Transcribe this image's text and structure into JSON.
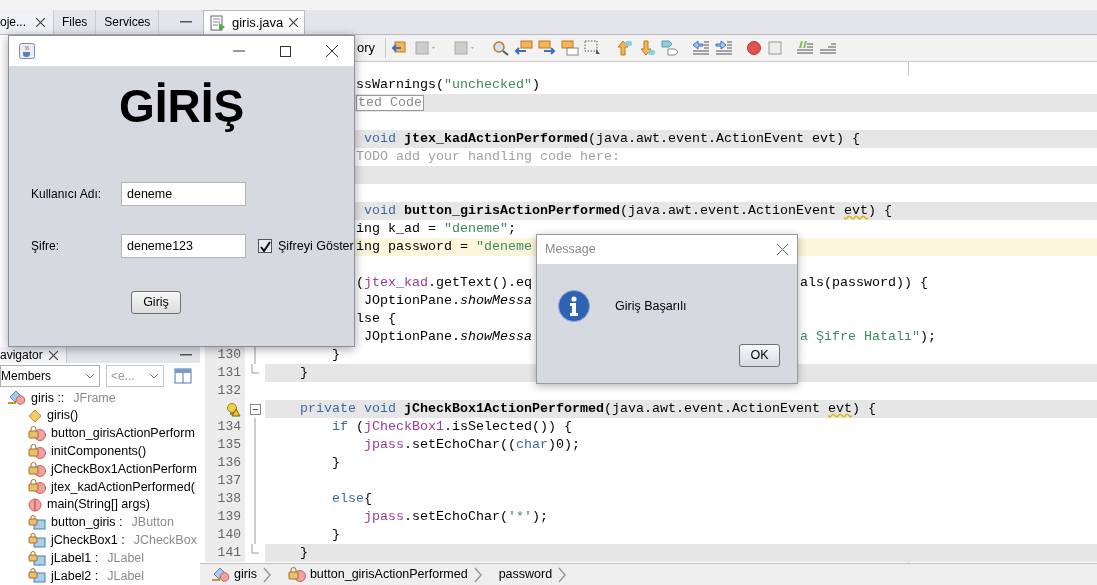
{
  "panel_tabs": [
    {
      "label": "oje...",
      "selected": true
    },
    {
      "label": "Files",
      "selected": false
    },
    {
      "label": "Services",
      "selected": false
    }
  ],
  "editor_tabs": [
    {
      "label": "giris.java",
      "selected": true
    }
  ],
  "toolbar": {
    "label": "ory"
  },
  "code_lines": [
    {
      "starts_hidden": true,
      "tokens": [
        {
          "text": "ssWarnings(",
          "kind": "plain"
        },
        {
          "text": "\"unchecked\"",
          "kind": "string"
        },
        {
          "text": ")",
          "kind": "plain"
        }
      ]
    },
    {
      "starts_hidden": true,
      "shaded": true,
      "tokens": [
        {
          "text": "ted Code",
          "kind": "fold"
        }
      ]
    },
    {
      "starts_hidden": true
    },
    {
      "starts_hidden": true,
      "shaded": true,
      "tokens": [
        {
          "text": " void ",
          "kind": "keyword"
        },
        {
          "text": "jtex_kadActionPerformed",
          "kind": "decl"
        },
        {
          "text": "(java.awt.event.ActionEvent evt) {",
          "kind": "plain"
        }
      ]
    },
    {
      "starts_hidden": true,
      "tokens": [
        {
          "text": "TODO add your handling code here:",
          "kind": "comment"
        }
      ]
    },
    {
      "starts_hidden": true,
      "shaded": true
    },
    {
      "starts_hidden": true
    },
    {
      "starts_hidden": true,
      "shaded": true,
      "tokens": [
        {
          "text": " void ",
          "kind": "keyword"
        },
        {
          "text": "button_girisActionPerformed",
          "kind": "decl"
        },
        {
          "text": "(java.awt.event.ActionEvent ",
          "kind": "plain"
        },
        {
          "text": "evt",
          "kind": "warn"
        },
        {
          "text": ") {",
          "kind": "plain"
        }
      ]
    },
    {
      "starts_hidden": true,
      "tokens": [
        {
          "text": "ing k_ad = ",
          "kind": "plain"
        },
        {
          "text": "\"deneme\"",
          "kind": "string"
        },
        {
          "text": ";",
          "kind": "plain"
        }
      ]
    },
    {
      "starts_hidden": true,
      "current": true,
      "tokens": [
        {
          "text": "ing password = ",
          "kind": "plain"
        },
        {
          "text": "\"deneme",
          "kind": "string"
        }
      ]
    },
    {
      "starts_hidden": true
    },
    {
      "starts_hidden": true,
      "tokens": [
        {
          "text": "(",
          "kind": "plain"
        },
        {
          "text": "jtex_kad",
          "kind": "field"
        },
        {
          "text": ".getText().eq",
          "kind": "plain"
        }
      ],
      "after": [
        {
          "text": "als(password)) {",
          "kind": "plain"
        }
      ]
    },
    {
      "starts_hidden": true,
      "tokens": [
        {
          "text": " JOptionPane.",
          "kind": "plain"
        },
        {
          "text": "showMessa",
          "kind": "static"
        }
      ]
    },
    {
      "starts_hidden": true,
      "tokens": [
        {
          "text": "lse {",
          "kind": "plain"
        }
      ]
    },
    {
      "starts_hidden": true,
      "tokens": [
        {
          "text": " JOptionPane.",
          "kind": "plain"
        },
        {
          "text": "showMessa",
          "kind": "static"
        }
      ],
      "after": [
        {
          "text": "a Şifre Hatalı\"",
          "kind": "string"
        },
        {
          "text": ");",
          "kind": "plain"
        }
      ]
    },
    {
      "number": "130",
      "fold_line": true,
      "tokens": [
        {
          "text": "        }",
          "kind": "plain"
        }
      ]
    },
    {
      "number": "131",
      "fold_end": true,
      "shaded": true,
      "tokens": [
        {
          "text": "    }",
          "kind": "plain"
        }
      ]
    },
    {
      "number": "132"
    },
    {
      "hint": true,
      "fold_toggle": true,
      "shaded": true,
      "tokens": [
        {
          "text": "    private void ",
          "kind": "keyword"
        },
        {
          "text": "jCheckBox1ActionPerformed",
          "kind": "decl"
        },
        {
          "text": "(java.awt.event.ActionEvent ",
          "kind": "plain"
        },
        {
          "text": "evt",
          "kind": "warn"
        },
        {
          "text": ") {",
          "kind": "plain"
        }
      ]
    },
    {
      "number": "134",
      "fold_line": true,
      "tokens": [
        {
          "text": "        if",
          "kind": "keyword"
        },
        {
          "text": " (",
          "kind": "plain"
        },
        {
          "text": "jCheckBox1",
          "kind": "field"
        },
        {
          "text": ".isSelected()) {",
          "kind": "plain"
        }
      ]
    },
    {
      "number": "135",
      "fold_line": true,
      "tokens": [
        {
          "text": "            jpass",
          "kind": "field"
        },
        {
          "text": ".setEchoChar((",
          "kind": "plain"
        },
        {
          "text": "char",
          "kind": "keyword"
        },
        {
          "text": ")0);",
          "kind": "plain"
        }
      ]
    },
    {
      "number": "136",
      "fold_line": true,
      "tokens": [
        {
          "text": "        }",
          "kind": "plain"
        }
      ]
    },
    {
      "number": "137",
      "fold_line": true
    },
    {
      "number": "138",
      "fold_line": true,
      "tokens": [
        {
          "text": "        else",
          "kind": "keyword"
        },
        {
          "text": "{",
          "kind": "plain"
        }
      ]
    },
    {
      "number": "139",
      "fold_line": true,
      "tokens": [
        {
          "text": "            jpass",
          "kind": "field"
        },
        {
          "text": ".setEchoChar(",
          "kind": "plain"
        },
        {
          "text": "'*'",
          "kind": "string"
        },
        {
          "text": ");",
          "kind": "plain"
        }
      ]
    },
    {
      "number": "140",
      "fold_line": true,
      "tokens": [
        {
          "text": "        }",
          "kind": "plain"
        }
      ]
    },
    {
      "number": "141",
      "fold_end": true,
      "shaded": true,
      "tokens": [
        {
          "text": "    }",
          "kind": "plain"
        }
      ]
    }
  ],
  "navigator": {
    "tab": "avigator",
    "member_filter": "Members",
    "second_filter": "<e...",
    "tree": {
      "name": "giris ::",
      "type": "JFrame",
      "kind": "class",
      "children": [
        {
          "name": "giris()",
          "kind": "constructor"
        },
        {
          "name": "button_girisActionPerform",
          "kind": "private-method"
        },
        {
          "name": "initComponents()",
          "kind": "private-method"
        },
        {
          "name": "jCheckBox1ActionPerform",
          "kind": "private-method"
        },
        {
          "name": "jtex_kadActionPerformed(",
          "kind": "private-method"
        },
        {
          "name": "main(String[] args)",
          "kind": "static-method"
        },
        {
          "name": "button_giris :",
          "type": "JButton",
          "kind": "private-field"
        },
        {
          "name": "jCheckBox1 :",
          "type": "JCheckBox",
          "kind": "private-field"
        },
        {
          "name": "jLabel1 :",
          "type": "JLabel",
          "kind": "private-field"
        },
        {
          "name": "jLabel2 :",
          "type": "JLabel",
          "kind": "private-field"
        }
      ]
    }
  },
  "breadcrumbs": [
    {
      "label": "giris",
      "kind": "class"
    },
    {
      "label": "button_girisActionPerformed",
      "kind": "private-method"
    },
    {
      "label": "password",
      "kind": "variable"
    }
  ],
  "login_window": {
    "heading": "GİRİŞ",
    "username_label": "Kullanıcı Adı:",
    "username_value": "deneme",
    "password_label": "Şifre:",
    "password_value": "deneme123",
    "show_password": {
      "label": "Şifreyi Göster",
      "checked": true
    },
    "submit": "Giriş"
  },
  "message_dialog": {
    "title": "Message",
    "message": "Giriş Başarılı",
    "button": "OK"
  }
}
